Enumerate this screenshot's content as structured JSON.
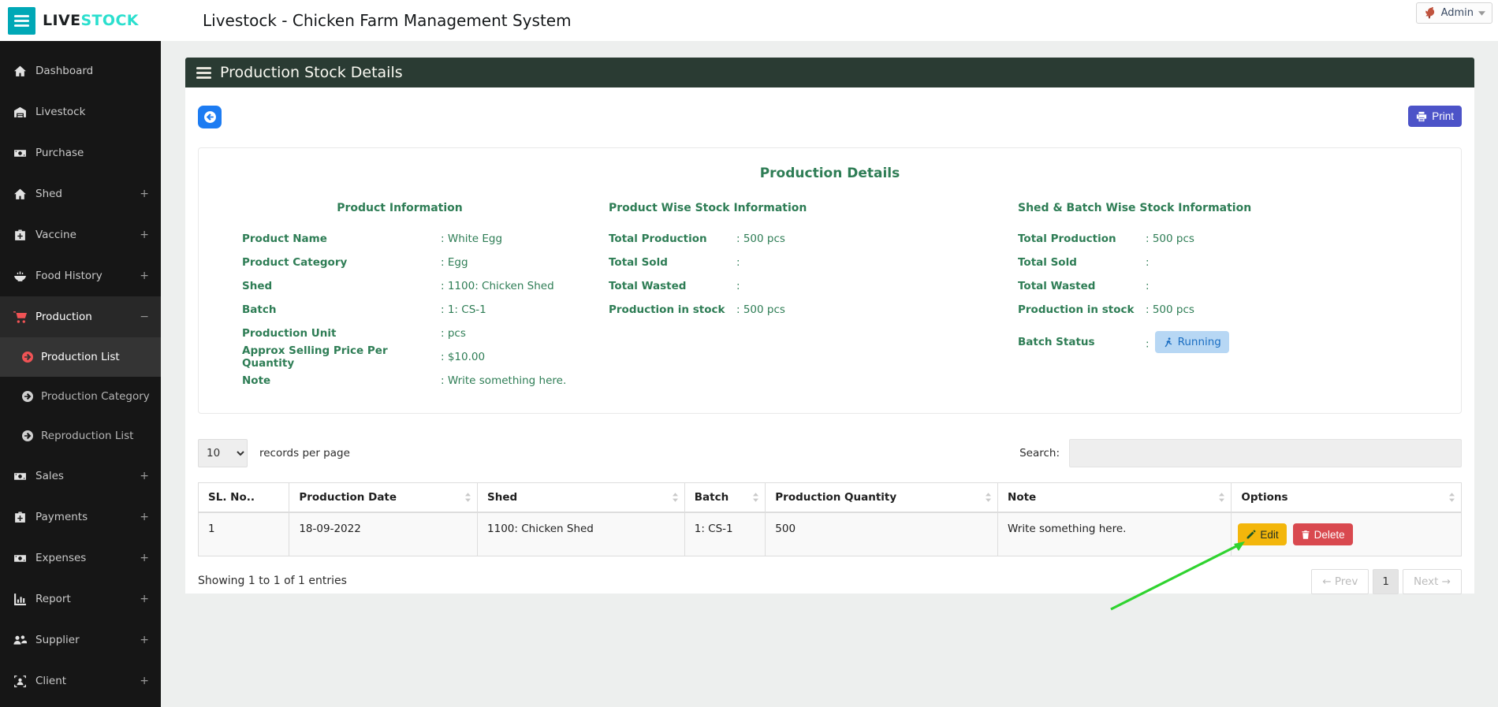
{
  "topbar": {
    "logo_live": "LIVE",
    "logo_stock": "STOCK",
    "title": "Livestock - Chicken Farm Management System",
    "menu_icon": "menu-icon",
    "user": {
      "name": "Admin",
      "icon": "rooster-icon",
      "caret_icon": "caret-down-icon"
    }
  },
  "sidebar": {
    "items": [
      {
        "icon": "home-icon",
        "label": "Dashboard"
      },
      {
        "icon": "farm-icon",
        "label": "Livestock"
      },
      {
        "icon": "money-icon",
        "label": "Purchase"
      },
      {
        "icon": "home-icon",
        "label": "Shed",
        "expand": "+"
      },
      {
        "icon": "medkit-icon",
        "label": "Vaccine",
        "expand": "+"
      },
      {
        "icon": "bowl-icon",
        "label": "Food History",
        "expand": "+"
      },
      {
        "icon": "cart-icon",
        "label": "Production",
        "expand": "−",
        "active": true,
        "children": [
          {
            "icon": "arrow-circle-icon",
            "label": "Production List",
            "active": true
          },
          {
            "icon": "arrow-circle-icon",
            "label": "Production Category"
          },
          {
            "icon": "arrow-circle-icon",
            "label": "Reproduction List"
          }
        ]
      },
      {
        "icon": "money-icon",
        "label": "Sales",
        "expand": "+"
      },
      {
        "icon": "medkit-icon",
        "label": "Payments",
        "expand": "+"
      },
      {
        "icon": "money-icon",
        "label": "Expenses",
        "expand": "+"
      },
      {
        "icon": "chart-icon",
        "label": "Report",
        "expand": "+"
      },
      {
        "icon": "users-icon",
        "label": "Supplier",
        "expand": "+"
      },
      {
        "icon": "users-frame-icon",
        "label": "Client",
        "expand": "+"
      }
    ]
  },
  "panel": {
    "header": "Production Stock Details",
    "header_icon": "menu-icon",
    "back_icon": "arrow-circle-left-icon",
    "print_label": "Print",
    "print_icon": "printer-icon"
  },
  "details": {
    "title": "Production Details",
    "sections": [
      {
        "heading": "Product Information",
        "rows": [
          {
            "label": "Product Name",
            "value": "White Egg"
          },
          {
            "label": "Product Category",
            "value": "Egg"
          },
          {
            "label": "Shed",
            "value": "1100: Chicken Shed"
          },
          {
            "label": "Batch",
            "value": "1: CS-1"
          },
          {
            "label": "Production Unit",
            "value": "pcs"
          },
          {
            "label": "Approx Selling Price Per Quantity",
            "value": "$10.00"
          },
          {
            "label": "Note",
            "value": "Write something here."
          }
        ]
      },
      {
        "heading": "Product Wise Stock Information",
        "rows": [
          {
            "label": "Total Production",
            "value": "500 pcs"
          },
          {
            "label": "Total Sold",
            "value": ""
          },
          {
            "label": "Total Wasted",
            "value": ""
          },
          {
            "label": "Production in stock",
            "value": "500 pcs"
          }
        ]
      },
      {
        "heading": "Shed & Batch Wise Stock Information",
        "rows": [
          {
            "label": "Total Production",
            "value": "500 pcs"
          },
          {
            "label": "Total Sold",
            "value": ""
          },
          {
            "label": "Total Wasted",
            "value": ""
          },
          {
            "label": "Production in stock",
            "value": "500 pcs"
          },
          {
            "label": "Batch Status",
            "value": "Running",
            "badge": true,
            "icon": "running-icon"
          }
        ]
      }
    ]
  },
  "table_controls": {
    "records_per_page": "10",
    "records_label": "records per page",
    "search_label": "Search:",
    "search_value": ""
  },
  "table": {
    "columns": [
      {
        "label": "SL. No..",
        "sortable": false
      },
      {
        "label": "Production Date",
        "sortable": true
      },
      {
        "label": "Shed",
        "sortable": true
      },
      {
        "label": "Batch",
        "sortable": true
      },
      {
        "label": "Production Quantity",
        "sortable": true
      },
      {
        "label": "Note",
        "sortable": true
      },
      {
        "label": "Options",
        "sortable": true
      }
    ],
    "sort_icon": "sort-icon",
    "rows": [
      {
        "sl_no": "1",
        "production_date": "18-09-2022",
        "shed": "1100: Chicken Shed",
        "batch": "1: CS-1",
        "production_quantity": "500",
        "note": "Write something here.",
        "options": {
          "edit_label": "Edit",
          "edit_icon": "pencil-icon",
          "delete_label": "Delete",
          "delete_icon": "trash-icon"
        }
      }
    ]
  },
  "footer": {
    "showing": "Showing 1 to 1 of 1 entries",
    "pagination": [
      {
        "label": "← Prev",
        "state": "disabled"
      },
      {
        "label": "1",
        "state": "active"
      },
      {
        "label": "Next →",
        "state": "disabled"
      }
    ]
  },
  "colors": {
    "accent_teal": "#00a8b6",
    "logo_cyan": "#2bdfce",
    "sidebar_bg": "#161616",
    "sidebar_active_bg": "#282828",
    "sidebar_subactive_bg": "#343434",
    "brand_red": "#f05355",
    "panel_header_bg": "#2a3b33",
    "green_text": "#2e7d55",
    "back_blue": "#1d7cf2",
    "print_indigo": "#4c53c8",
    "edit_yellow": "#f3b60b",
    "delete_red": "#d9494f",
    "badge_bg": "#b7d7f4",
    "badge_text": "#1b6ec2",
    "arrow_green": "#2fd32f",
    "main_bg": "#edefee"
  }
}
